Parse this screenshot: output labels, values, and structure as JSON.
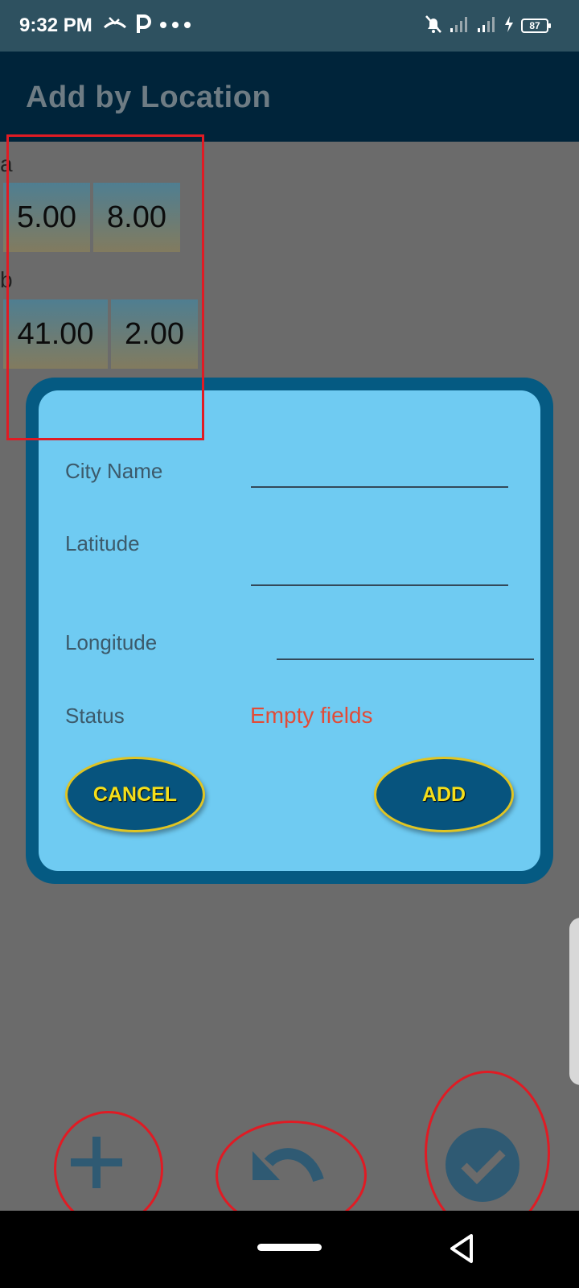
{
  "status_bar": {
    "time": "9:32 PM",
    "icons_left": [
      "missed-call-icon",
      "parking-icon",
      "more-dots-icon"
    ],
    "icons_right": [
      "bell-off-icon",
      "signal-icon",
      "signal-icon",
      "charging-icon"
    ],
    "battery_level": "87"
  },
  "app_bar": {
    "title": "Add by Location"
  },
  "background_list": {
    "rows": [
      {
        "label": "a",
        "values": [
          "5.00",
          "8.00"
        ]
      },
      {
        "label": "b",
        "values": [
          "41.00",
          "2.00"
        ]
      }
    ]
  },
  "dialog": {
    "fields": [
      {
        "label": "City Name",
        "value": ""
      },
      {
        "label": "Latitude",
        "value": ""
      },
      {
        "label": "Longitude",
        "value": ""
      }
    ],
    "status_label": "Status",
    "status_value": "Empty fields",
    "cancel_label": "CANCEL",
    "add_label": "ADD"
  },
  "bottom_actions": [
    "plus-icon",
    "undo-icon",
    "check-icon"
  ],
  "colors": {
    "app_bar": "#00243a",
    "dialog_border": "#055a82",
    "dialog_bg": "#6fcbf2",
    "button_bg": "#07547e",
    "button_text": "#f6df1a",
    "status_error": "#e24b37",
    "annotation": "#e01b24"
  }
}
